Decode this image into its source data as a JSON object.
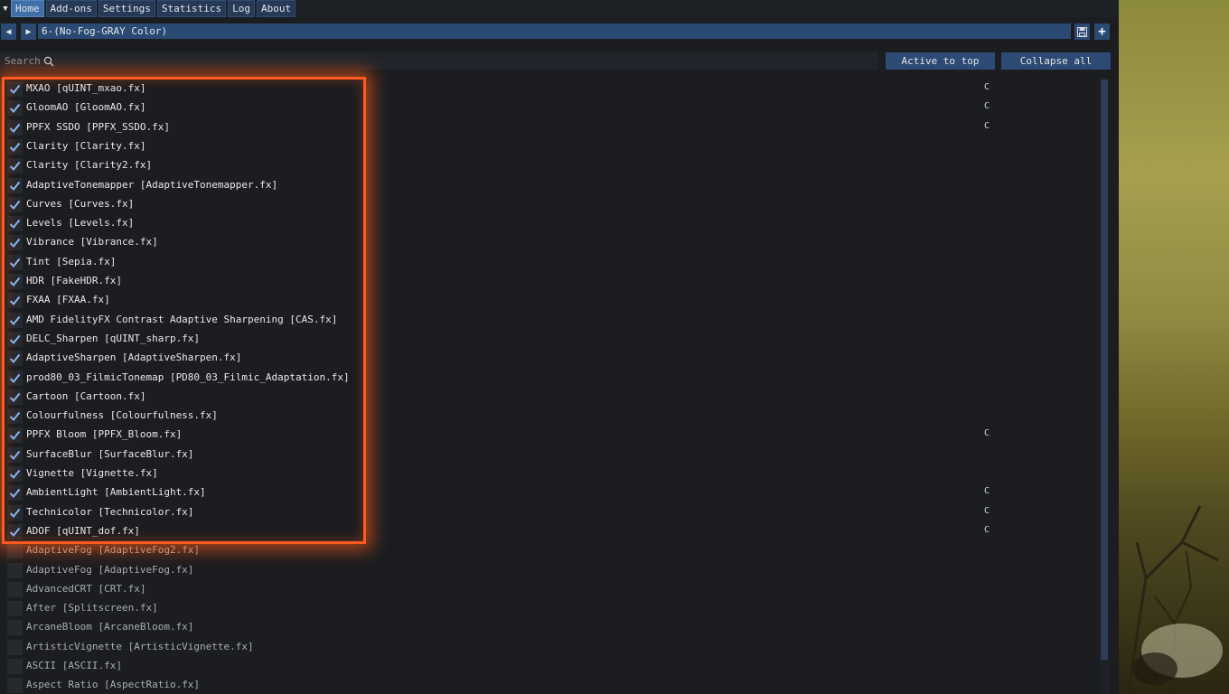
{
  "menu": {
    "tabs": [
      {
        "label": "Home",
        "active": true
      },
      {
        "label": "Add-ons",
        "active": false
      },
      {
        "label": "Settings",
        "active": false
      },
      {
        "label": "Statistics",
        "active": false
      },
      {
        "label": "Log",
        "active": false
      },
      {
        "label": "About",
        "active": false
      }
    ]
  },
  "preset": {
    "name": "6-(No-Fog-GRAY Color)",
    "prev_icon": "triangle-left-icon",
    "next_icon": "triangle-right-icon",
    "save_icon": "floppy-disk-icon",
    "add_icon": "plus-icon",
    "add_glyph": "+"
  },
  "search": {
    "placeholder": "Search",
    "value": "",
    "icon": "magnifier-icon"
  },
  "buttons": {
    "active_to_top": "Active to top",
    "collapse_all": "Collapse all"
  },
  "effects": [
    {
      "label": "MXAO [qUINT_mxao.fx]",
      "checked": true,
      "badge": "C"
    },
    {
      "label": "GloomAO [GloomAO.fx]",
      "checked": true,
      "badge": "C"
    },
    {
      "label": "PPFX SSDO [PPFX_SSDO.fx]",
      "checked": true,
      "badge": "C"
    },
    {
      "label": "Clarity [Clarity.fx]",
      "checked": true,
      "badge": ""
    },
    {
      "label": "Clarity [Clarity2.fx]",
      "checked": true,
      "badge": ""
    },
    {
      "label": "AdaptiveTonemapper [AdaptiveTonemapper.fx]",
      "checked": true,
      "badge": ""
    },
    {
      "label": "Curves [Curves.fx]",
      "checked": true,
      "badge": ""
    },
    {
      "label": "Levels [Levels.fx]",
      "checked": true,
      "badge": ""
    },
    {
      "label": "Vibrance [Vibrance.fx]",
      "checked": true,
      "badge": ""
    },
    {
      "label": "Tint [Sepia.fx]",
      "checked": true,
      "badge": ""
    },
    {
      "label": "HDR [FakeHDR.fx]",
      "checked": true,
      "badge": ""
    },
    {
      "label": "FXAA [FXAA.fx]",
      "checked": true,
      "badge": ""
    },
    {
      "label": "AMD FidelityFX Contrast Adaptive Sharpening [CAS.fx]",
      "checked": true,
      "badge": ""
    },
    {
      "label": "DELC_Sharpen [qUINT_sharp.fx]",
      "checked": true,
      "badge": ""
    },
    {
      "label": "AdaptiveSharpen [AdaptiveSharpen.fx]",
      "checked": true,
      "badge": ""
    },
    {
      "label": "prod80_03_FilmicTonemap [PD80_03_Filmic_Adaptation.fx]",
      "checked": true,
      "badge": ""
    },
    {
      "label": "Cartoon [Cartoon.fx]",
      "checked": true,
      "badge": ""
    },
    {
      "label": "Colourfulness [Colourfulness.fx]",
      "checked": true,
      "badge": ""
    },
    {
      "label": "PPFX Bloom [PPFX_Bloom.fx]",
      "checked": true,
      "badge": "C"
    },
    {
      "label": "SurfaceBlur [SurfaceBlur.fx]",
      "checked": true,
      "badge": ""
    },
    {
      "label": "Vignette [Vignette.fx]",
      "checked": true,
      "badge": ""
    },
    {
      "label": "AmbientLight [AmbientLight.fx]",
      "checked": true,
      "badge": "C"
    },
    {
      "label": "Technicolor [Technicolor.fx]",
      "checked": true,
      "badge": "C"
    },
    {
      "label": "ADOF [qUINT_dof.fx]",
      "checked": true,
      "badge": "C"
    },
    {
      "label": "AdaptiveFog [AdaptiveFog2.fx]",
      "checked": false,
      "badge": "",
      "state": "danger"
    },
    {
      "label": "AdaptiveFog [AdaptiveFog.fx]",
      "checked": false,
      "badge": ""
    },
    {
      "label": "AdvancedCRT [CRT.fx]",
      "checked": false,
      "badge": ""
    },
    {
      "label": "After [Splitscreen.fx]",
      "checked": false,
      "badge": ""
    },
    {
      "label": "ArcaneBloom [ArcaneBloom.fx]",
      "checked": false,
      "badge": ""
    },
    {
      "label": "ArtisticVignette [ArtisticVignette.fx]",
      "checked": false,
      "badge": ""
    },
    {
      "label": "ASCII [ASCII.fx]",
      "checked": false,
      "badge": ""
    },
    {
      "label": "Aspect Ratio [AspectRatio.fx]",
      "checked": false,
      "badge": ""
    }
  ],
  "colors": {
    "accent": "#3f6ea8",
    "highlight": "#ff5a1f",
    "check": "#8fb4e8"
  }
}
